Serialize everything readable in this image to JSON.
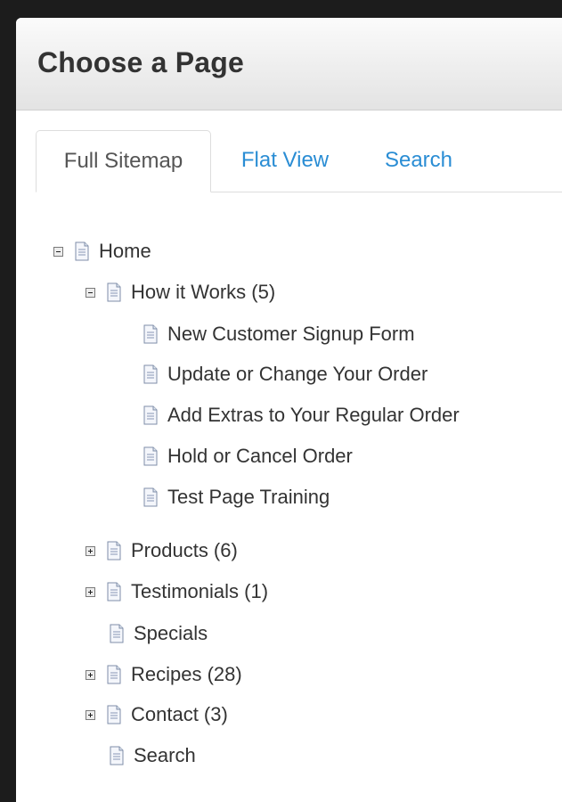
{
  "dialog": {
    "title": "Choose a Page"
  },
  "tabs": [
    {
      "label": "Full Sitemap",
      "active": true
    },
    {
      "label": "Flat View",
      "active": false
    },
    {
      "label": "Search",
      "active": false
    }
  ],
  "tree": [
    {
      "label": "Home",
      "toggle": "collapse"
    },
    {
      "label": "How it Works (5)",
      "toggle": "collapse"
    },
    {
      "label": "New Customer Signup Form",
      "toggle": "none"
    },
    {
      "label": "Update or Change Your Order",
      "toggle": "none"
    },
    {
      "label": "Add Extras to Your Regular Order",
      "toggle": "none"
    },
    {
      "label": "Hold or Cancel Order",
      "toggle": "none"
    },
    {
      "label": "Test Page Training",
      "toggle": "none"
    },
    {
      "label": "Products (6)",
      "toggle": "expand"
    },
    {
      "label": "Testimonials (1)",
      "toggle": "expand"
    },
    {
      "label": "Specials",
      "toggle": "none"
    },
    {
      "label": "Recipes (28)",
      "toggle": "expand"
    },
    {
      "label": "Contact (3)",
      "toggle": "expand"
    },
    {
      "label": "Search",
      "toggle": "none"
    }
  ],
  "colors": {
    "tab_link": "#2a8dd4",
    "text": "#333333",
    "header_top": "#fbfbfb",
    "header_bottom": "#e3e3e3"
  },
  "icons": {
    "collapse": "minus-box-icon",
    "expand": "plus-box-icon",
    "page": "document-page-icon"
  }
}
